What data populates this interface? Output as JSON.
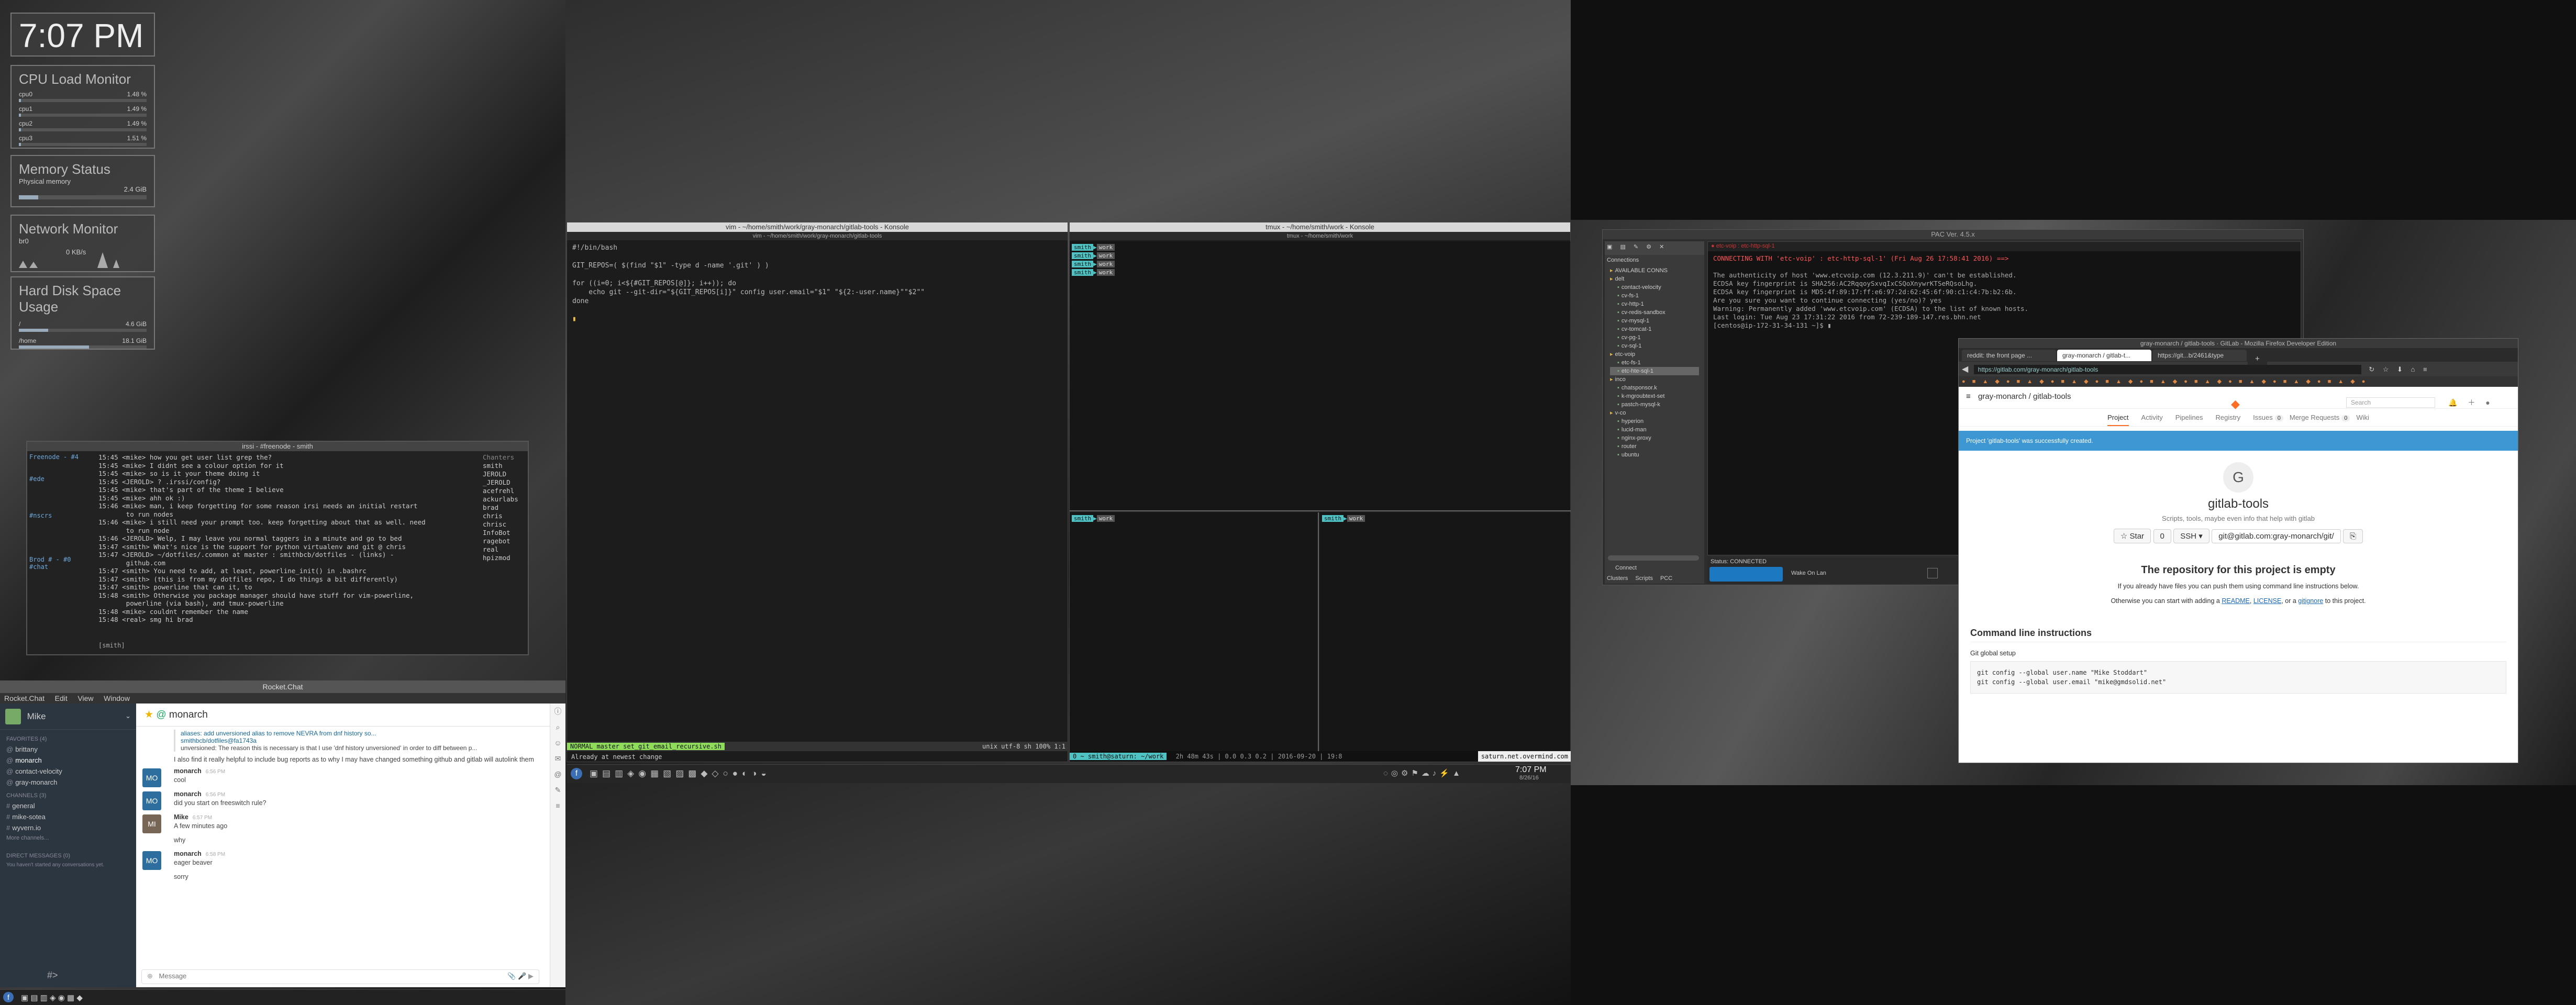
{
  "clock": {
    "time": "7:07 PM"
  },
  "cpu": {
    "title": "CPU Load Monitor",
    "cores": [
      {
        "label": "cpu0",
        "val": "1.48 %",
        "pct": 1.48
      },
      {
        "label": "cpu1",
        "val": "1.49 %",
        "pct": 1.49
      },
      {
        "label": "cpu2",
        "val": "1.49 %",
        "pct": 1.49
      },
      {
        "label": "cpu3",
        "val": "1.51 %",
        "pct": 1.51
      }
    ]
  },
  "memory": {
    "title": "Memory Status",
    "label": "Physical memory",
    "value": "2.4 GiB",
    "pct": 15
  },
  "network": {
    "title": "Network Monitor",
    "iface": "br0",
    "rate": "0 KB/s",
    "rate2": "0 KB/s"
  },
  "disk": {
    "title": "Hard Disk Space Usage",
    "items": [
      {
        "label": "/",
        "val": "4.6 GiB",
        "pct": 23
      },
      {
        "label": "/home",
        "val": "18.1 GiB",
        "pct": 55
      }
    ]
  },
  "irc": {
    "title": "irssi - #freenode - smith",
    "channels": [
      "Freenode - #4",
      "",
      "",
      "#ede",
      "",
      "",
      "",
      "",
      "#nscrs",
      "",
      "",
      "",
      "",
      "",
      "Brod # - #0",
      "#chat"
    ],
    "lines": [
      "15:45 <mike> how you get user list grep the?",
      "15:45 <mike> I didnt see a colour option for it",
      "15:45 <mike> so is it your theme doing it",
      "15:45 <JEROLD> ? .irssi/config?",
      "15:45 <mike> that's part of the theme I believe",
      "15:45 <mike> ahh ok :)",
      "15:46 <mike> man, i keep forgetting for some reason irsi needs an initial restart",
      "       to run nodes",
      "15:46 <mike> i still need your prompt too. keep forgetting about that as well. need",
      "       to run node",
      "15:46 <JEROLD> Welp, I may leave you normal taggers in a minute and go to bed",
      "15:47 <smith> What's nice is the support for python virtualenv and git @ chris",
      "15:47 <JEROLD> ~/dotfiles/.common at master : smithbcb/dotfiles - (links) -",
      "       github.com",
      "15:47 <smith> You need to add, at least, powerline_init() in .bashrc",
      "15:47 <smith> (this is from my dotfiles repo, I do things a bit differently)",
      "15:47 <smith> powerline that can it, to",
      "15:48 <smith> Otherwise you package manager should have stuff for vim-powerline,",
      "       powerline (via bash), and tmux-powerline",
      "15:48 <mike> couldnt remember the name",
      "15:48 <real> smg hi brad"
    ],
    "nicks": [
      "Chanters",
      "smith",
      "JEROLD",
      "_JEROLD",
      "acefrehl",
      "ackurlabs",
      "brad",
      "chris",
      "chrisc",
      "InfoBot",
      "ragebot",
      "real",
      "hpizmod"
    ],
    "input": "[smith]"
  },
  "rocket": {
    "app_title": "Rocket.Chat",
    "menu": [
      "Rocket.Chat",
      "Edit",
      "View",
      "Window"
    ],
    "user": "Mike",
    "favorites_header": "FAVORITES (4)",
    "favorites": [
      "brittany",
      "monarch",
      "contact-velocity",
      "gray-monarch"
    ],
    "channels_header": "CHANNELS (3)",
    "channels": [
      "general",
      "mike-sotea",
      "wyvern.io"
    ],
    "more_channels": "More channels...",
    "dm_header": "DIRECT MESSAGES (0)",
    "dm_note": "You haven't started any conversations yet.",
    "room": "monarch",
    "quote_title": "aliases: add unversioned alias to remove NEVRA from dnf history so...",
    "quote_sub": "smithbcb/dotfiles@fa1743a",
    "quote_body": "unversioned: The reason this is necessary is that I use 'dnf history unversioned' in order to diff between p...",
    "intro": "I also find it really helpful to include bug reports as to why I may have changed something github and gitlab will autolink them",
    "messages": [
      {
        "avatar": "MO",
        "user": "monarch",
        "time": "6:56 PM",
        "text": "cool"
      },
      {
        "avatar": "MO",
        "user": "monarch",
        "time": "6:56 PM",
        "text": "did you start on freeswitch rule?"
      },
      {
        "avatar": "MI",
        "user": "Mike",
        "time": "6:57 PM",
        "text": "A few minutes ago"
      },
      {
        "avatar": "",
        "user": "",
        "time": "",
        "text": "why"
      },
      {
        "avatar": "MO",
        "user": "monarch",
        "time": "6:58 PM",
        "text": "eager beaver"
      },
      {
        "avatar": "",
        "user": "",
        "time": "",
        "text": "sorry"
      }
    ],
    "placeholder": "Message",
    "rocket_badge": "#>"
  },
  "term1": {
    "title": "vim - ~/home/smith/work/gray-monarch/gitlab-tools - Konsole",
    "subtitle": "vim - ~/home/smith/work/gray-monarch/gitlab-tools",
    "lines": [
      "#!/bin/bash",
      "",
      "GIT_REPOS=( $(find \"$1\" -type d -name '.git' ) )",
      "",
      "for ((i=0; i<${#GIT_REPOS[@]}; i++)); do",
      "    echo git --git-dir=\"${GIT_REPOS[i]}\" config user.email=\"$1\" \"${2:-user.name}\"\"$2\"\"",
      "done",
      "",
      "▮"
    ],
    "status": "NORMAL  master  set_git_email_recursive.sh",
    "status_right": "unix  utf-8  sh  100%  1:1",
    "cmd": "Already at newest change"
  },
  "term2": {
    "title": "tmux - ~/home/smith/work - Konsole",
    "subtitle": "tmux - ~/home/smith/work",
    "prompt_user": "smith",
    "prompt_dir": "work",
    "status_left": "0 ~ smith@saturn: ~/work",
    "status_mid": "2h 48m 43s  |  0.0 0.3 0.2  |  2016-09-20  |  19:8",
    "status_right": "saturn.net.overmind.com"
  },
  "dbeaver": {
    "title": "PAC Ver. 4.5.x",
    "conn_header": "Connections",
    "tree": [
      "AVAILABLE CONNS",
      "delt",
      "contact-velocity",
      "cv-fs-1",
      "cv-http-1",
      "cv-redis-sandbox",
      "cv-mysql-1",
      "cv-tomcat-1",
      "cv-pg-1",
      "cv-sql-1",
      "etc-voip",
      "etc-fs-1",
      "etc-hte-sql-1",
      "inco",
      "chatsponsor.k",
      "k-mgroubtext-set",
      "pastch-mysql-k",
      "v-co",
      "hyperion",
      "lucid-man",
      "nginx-proxy",
      "router",
      "ubuntu"
    ],
    "bottom_tabs": [
      "Clusters",
      "Scripts",
      "PCC"
    ],
    "connect": "Connect",
    "status": "Status: CONNECTED",
    "wake": "Wake On Lan",
    "term_lines": [
      "CONNECTING WITH 'etc-voip' : etc-http-sql-1' (Fri Aug 26 17:58:41 2016) ==>",
      "",
      "The authenticity of host 'www.etcvoip.com (12.3.211.9)' can't be established.",
      "ECDSA key fingerprint is SHA256:AC2RqqoySxvqIxCSQoXnywrKTSeRQsoLhg.",
      "ECDSA key fingerprint is MD5:4f:89:17:ff:e6:97:2d:62:45:6f:90:c1:c4:7b:b2:6b.",
      "Are you sure you want to continue connecting (yes/no)? yes",
      "Warning: Permanently added 'www.etcvoip.com' (ECDSA) to the list of known hosts.",
      "Last login: Tue Aug 23 17:31:22 2016 from 72-239-189-147.res.bhn.net",
      "[centos@ip-172-31-34-131 ~]$ ▮"
    ]
  },
  "browser": {
    "title": "gray-monarch / gitlab-tools · GitLab - Mozilla Firefox Developer Edition",
    "tabs": [
      "reddit: the front page ...",
      "gray-monarch / gitlab-t...",
      "https://git...b/2461&type"
    ],
    "url": "https://gitlab.com/gray-monarch/gitlab-tools",
    "crumb": "gray-monarch / gitlab-tools",
    "search": "Search",
    "nav": [
      "Project",
      "Activity",
      "Pipelines",
      "Registry",
      "Issues",
      "Merge Requests",
      "Wiki"
    ],
    "issues_count": "0",
    "mr_count": "0",
    "flash": "Project 'gitlab-tools' was successfully created.",
    "avatar_letter": "G",
    "project": "gitlab-tools",
    "desc": "Scripts, tools, maybe even info that help with gitlab",
    "star": "Star",
    "star_count": "0",
    "ssh": "SSH",
    "clone": "git@gitlab.com:gray-monarch/git/",
    "empty_title": "The repository for this project is empty",
    "empty_1": "If you already have files you can push them using command line instructions below.",
    "empty_2a": "Otherwise you can start with adding a",
    "readme": "README",
    "license": "LICENSE",
    "gitignore": "gitignore",
    "empty_2b": "to this project.",
    "cli_title": "Command line instructions",
    "global": "Git global setup",
    "code": [
      "git config --global user.name \"Mike Stoddart\"",
      "git config --global user.email \"mike@gmdsolid.net\""
    ]
  },
  "taskbar": {
    "time": "7:07 PM",
    "date": "8/26/16",
    "apps": [
      "Konsole",
      "Konsole",
      "Firefox",
      "Rocket.Chat",
      "irssi",
      "PAC"
    ]
  },
  "colors": {
    "accent": "#FC6D26",
    "gitlab_flash": "#3C97D3",
    "rocket_accent": "#2E6E9E",
    "powerline_green": "#8FDC5A"
  }
}
